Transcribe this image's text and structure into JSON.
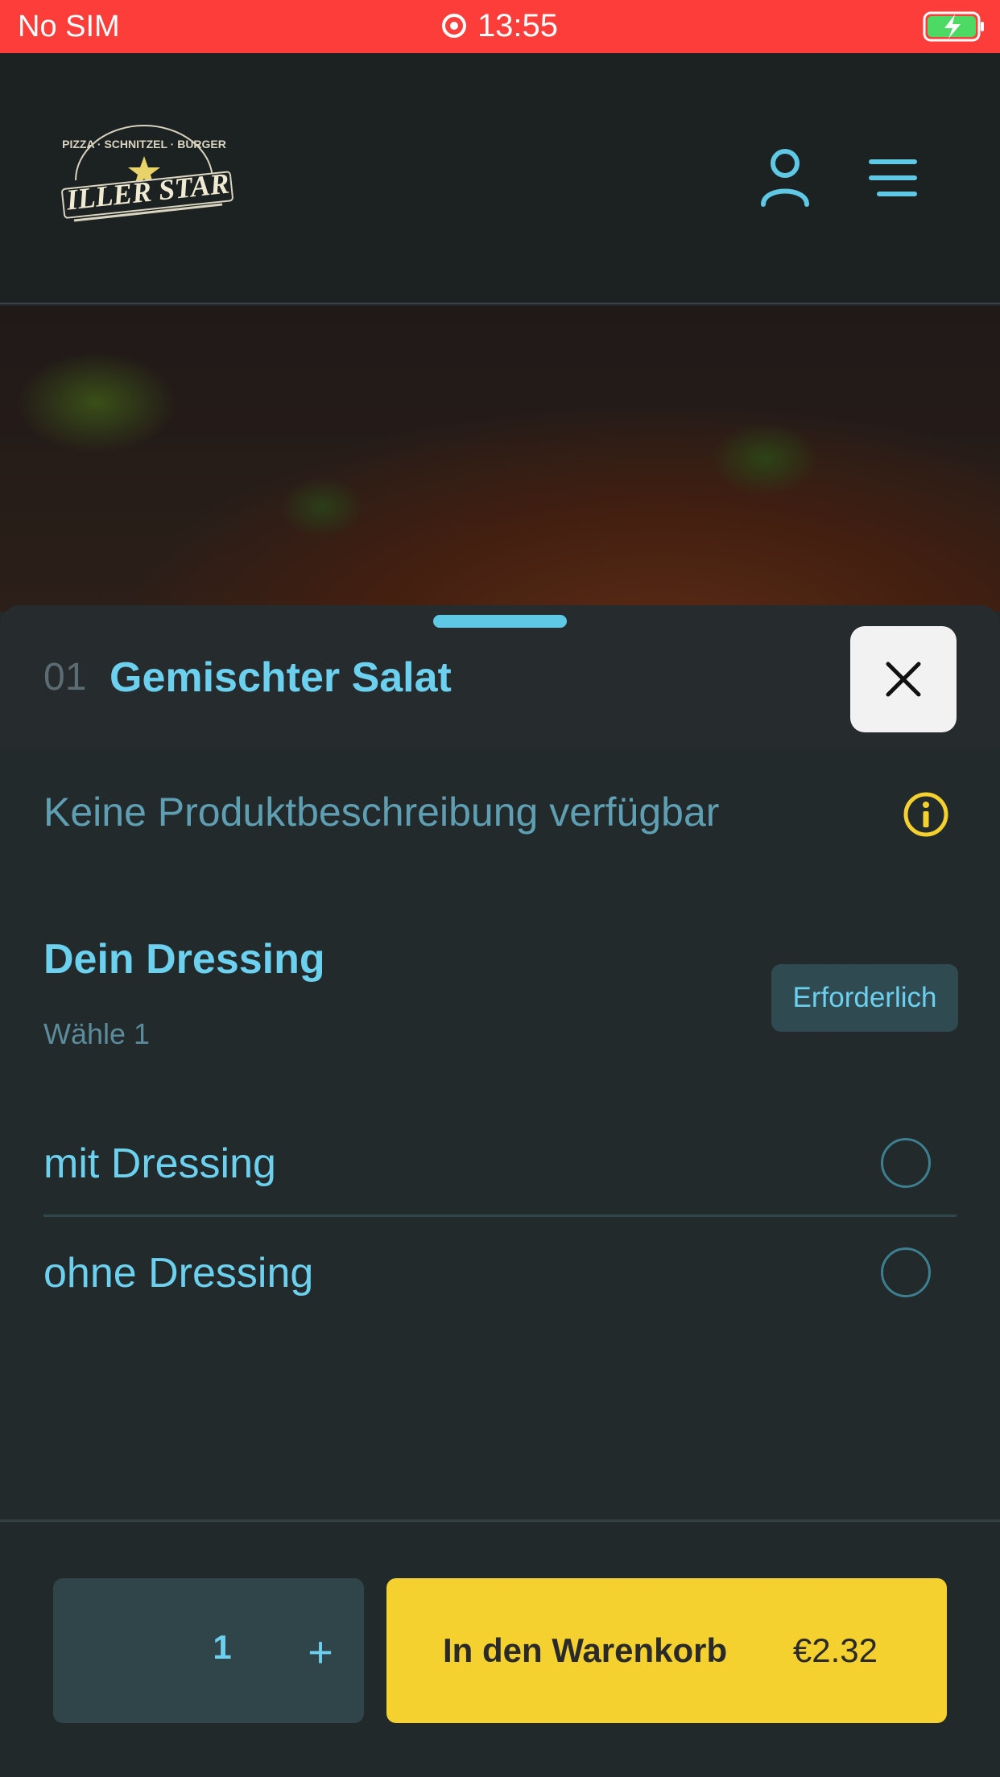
{
  "status_bar": {
    "carrier": "No SIM",
    "time": "13:55"
  },
  "header": {
    "logo": {
      "arc_text": "PIZZA · SCHNITZEL · BURGER",
      "wordmark": "ILLER STAR"
    },
    "icons": [
      "user-icon",
      "menu-icon"
    ]
  },
  "product": {
    "number": "01",
    "title": "Gemischter Salat",
    "description": "Keine Produktbeschreibung verfügbar"
  },
  "option_group": {
    "title": "Dein Dressing",
    "subtitle": "Wähle 1",
    "badge": "Erforderlich",
    "options": [
      {
        "label": "mit Dressing",
        "selected": false
      },
      {
        "label": "ohne Dressing",
        "selected": false
      }
    ]
  },
  "footer": {
    "quantity": "1",
    "plus_label": "+",
    "cart_label": "In den Warenkorb",
    "price": "€2.32"
  },
  "colors": {
    "status_bar": "#fc3d39",
    "accent": "#6cd0ef",
    "cart_button": "#f5d130",
    "info_icon": "#f5d130"
  }
}
